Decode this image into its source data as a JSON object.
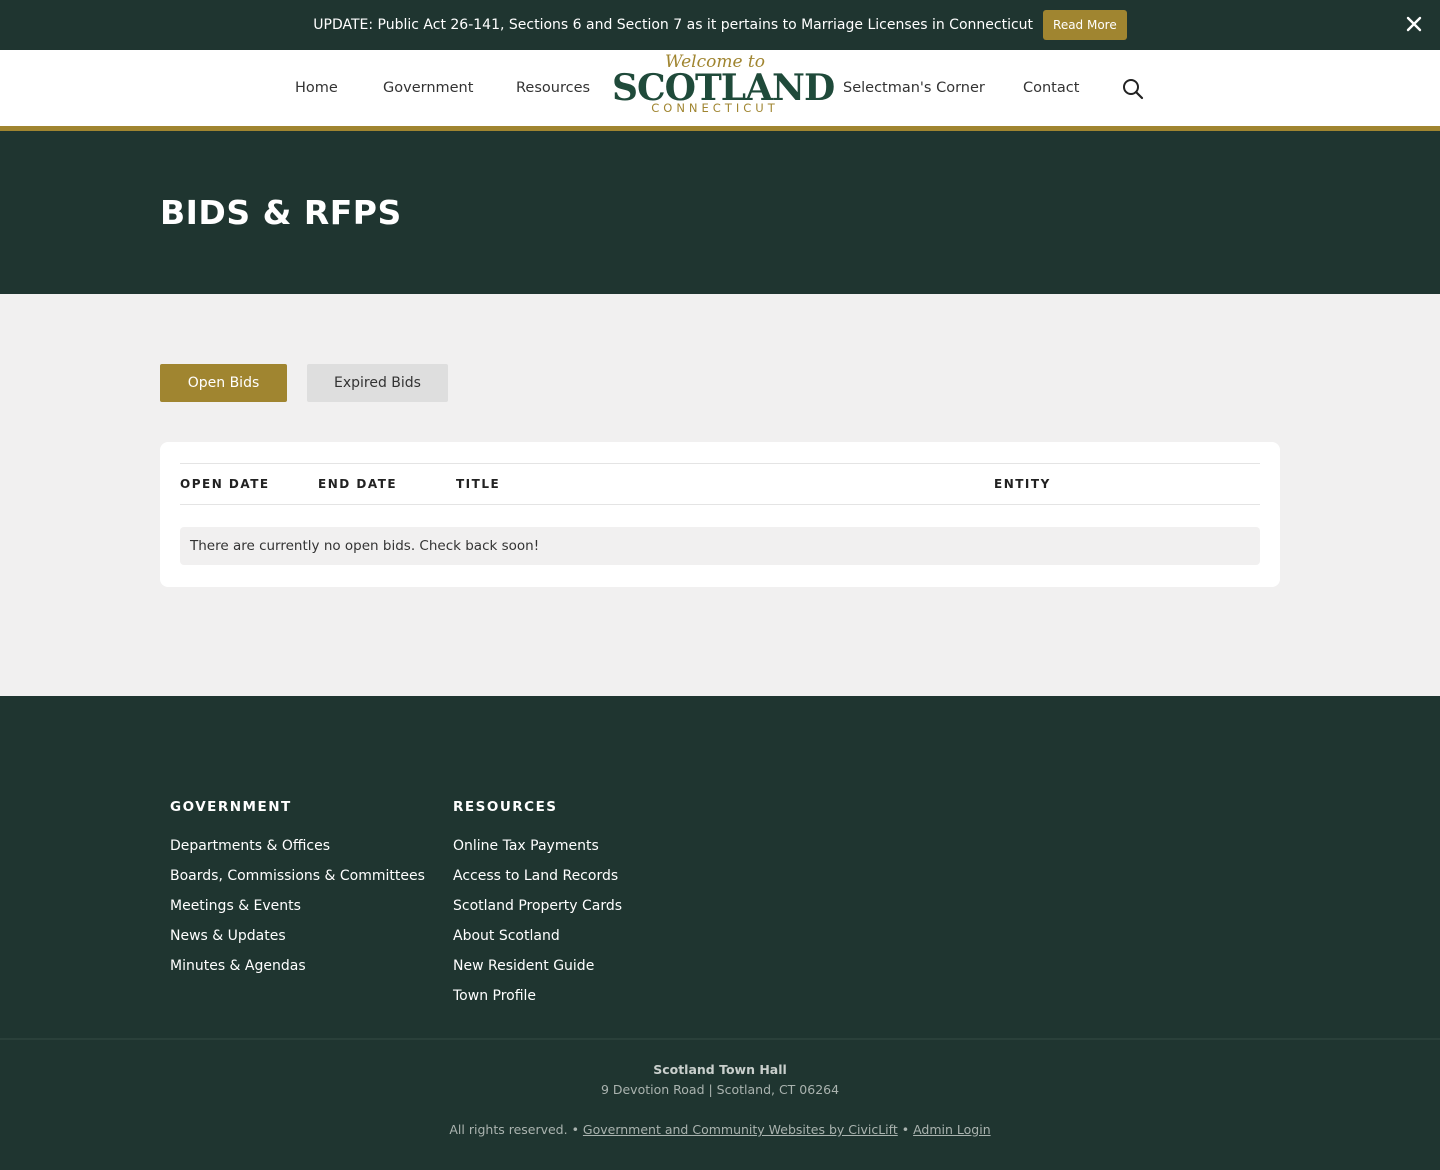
{
  "alert": {
    "message": "UPDATE: Public Act 26-141, Sections 6 and Section 7 as it pertains to Marriage Licenses in Connecticut",
    "read_more_label": "Read More",
    "close_icon": "close-icon"
  },
  "nav": {
    "home": "Home",
    "government": "Government",
    "resources": "Resources",
    "selectmans_corner": "Selectman's Corner",
    "contact": "Contact",
    "search_icon": "search-icon"
  },
  "logo": {
    "welcome": "Welcome to",
    "name": "SCOTLAND",
    "state": "CONNECTICUT"
  },
  "page": {
    "title": "BIDS & RFPS"
  },
  "tabs": [
    {
      "label": "Open Bids",
      "active": true
    },
    {
      "label": "Expired Bids",
      "active": false
    }
  ],
  "table": {
    "headers": [
      "OPEN DATE",
      "END DATE",
      "TITLE",
      "ENTITY"
    ],
    "empty_message": "There are currently no open bids. Check back soon!"
  },
  "footer": {
    "government": {
      "title": "GOVERNMENT",
      "links": [
        "Departments & Offices",
        "Boards, Commissions & Committees",
        "Meetings & Events",
        "News & Updates",
        "Minutes & Agendas"
      ]
    },
    "resources": {
      "title": "RESOURCES",
      "links": [
        "Online Tax Payments",
        "Access to Land Records",
        "Scotland Property Cards",
        "About Scotland",
        "New Resident Guide",
        "Town Profile"
      ]
    },
    "address": {
      "name": "Scotland Town Hall",
      "line": "9 Devotion Road | Scotland, CT  06264"
    },
    "legal": {
      "rights": "All rights reserved. • ",
      "civiclift": "Government and Community Websites by CivicLift",
      "sep": " • ",
      "admin": "Admin Login"
    }
  },
  "colors": {
    "dark_green": "#1f3530",
    "gold": "#a08530",
    "page_bg": "#f1f0f0"
  }
}
